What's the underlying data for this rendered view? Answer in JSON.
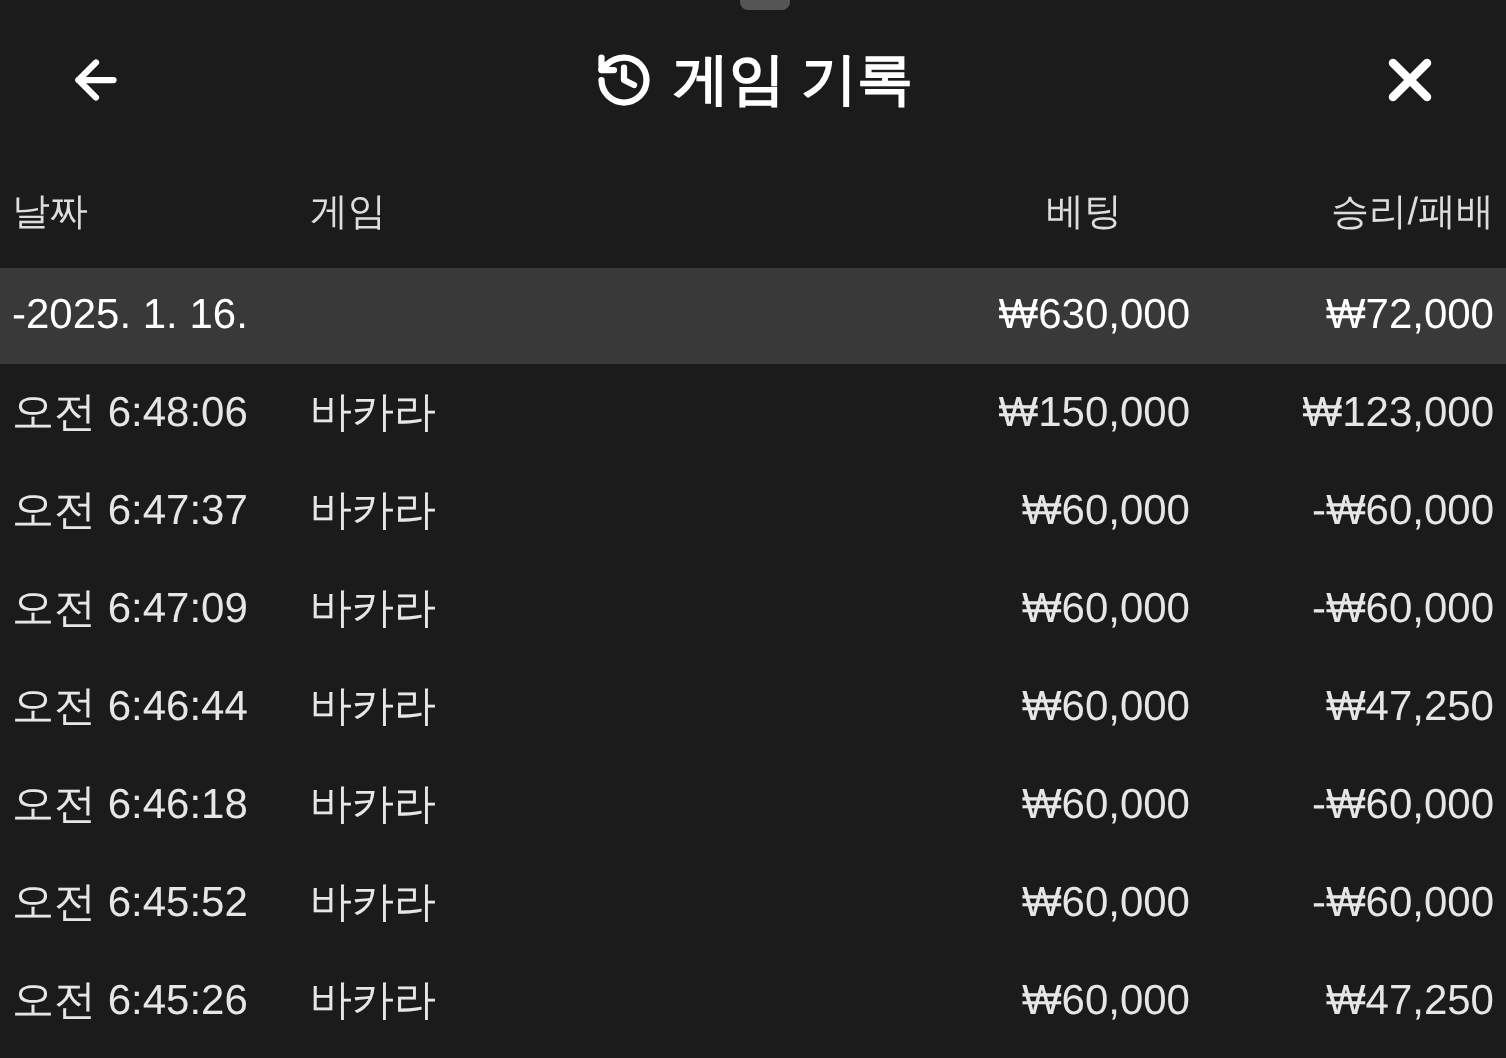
{
  "header": {
    "title": "게임 기록"
  },
  "columns": [
    "날짜",
    "게임",
    "베팅",
    "승리/패배"
  ],
  "group": {
    "date": "-2025. 1. 16.",
    "bet": "₩630,000",
    "result": "₩72,000"
  },
  "rows": [
    {
      "time": "오전 6:48:06",
      "game": "바카라",
      "bet": "₩150,000",
      "result": "₩123,000"
    },
    {
      "time": "오전 6:47:37",
      "game": "바카라",
      "bet": "₩60,000",
      "result": "-₩60,000"
    },
    {
      "time": "오전 6:47:09",
      "game": "바카라",
      "bet": "₩60,000",
      "result": "-₩60,000"
    },
    {
      "time": "오전 6:46:44",
      "game": "바카라",
      "bet": "₩60,000",
      "result": "₩47,250"
    },
    {
      "time": "오전 6:46:18",
      "game": "바카라",
      "bet": "₩60,000",
      "result": "-₩60,000"
    },
    {
      "time": "오전 6:45:52",
      "game": "바카라",
      "bet": "₩60,000",
      "result": "-₩60,000"
    },
    {
      "time": "오전 6:45:26",
      "game": "바카라",
      "bet": "₩60,000",
      "result": "₩47,250"
    }
  ]
}
